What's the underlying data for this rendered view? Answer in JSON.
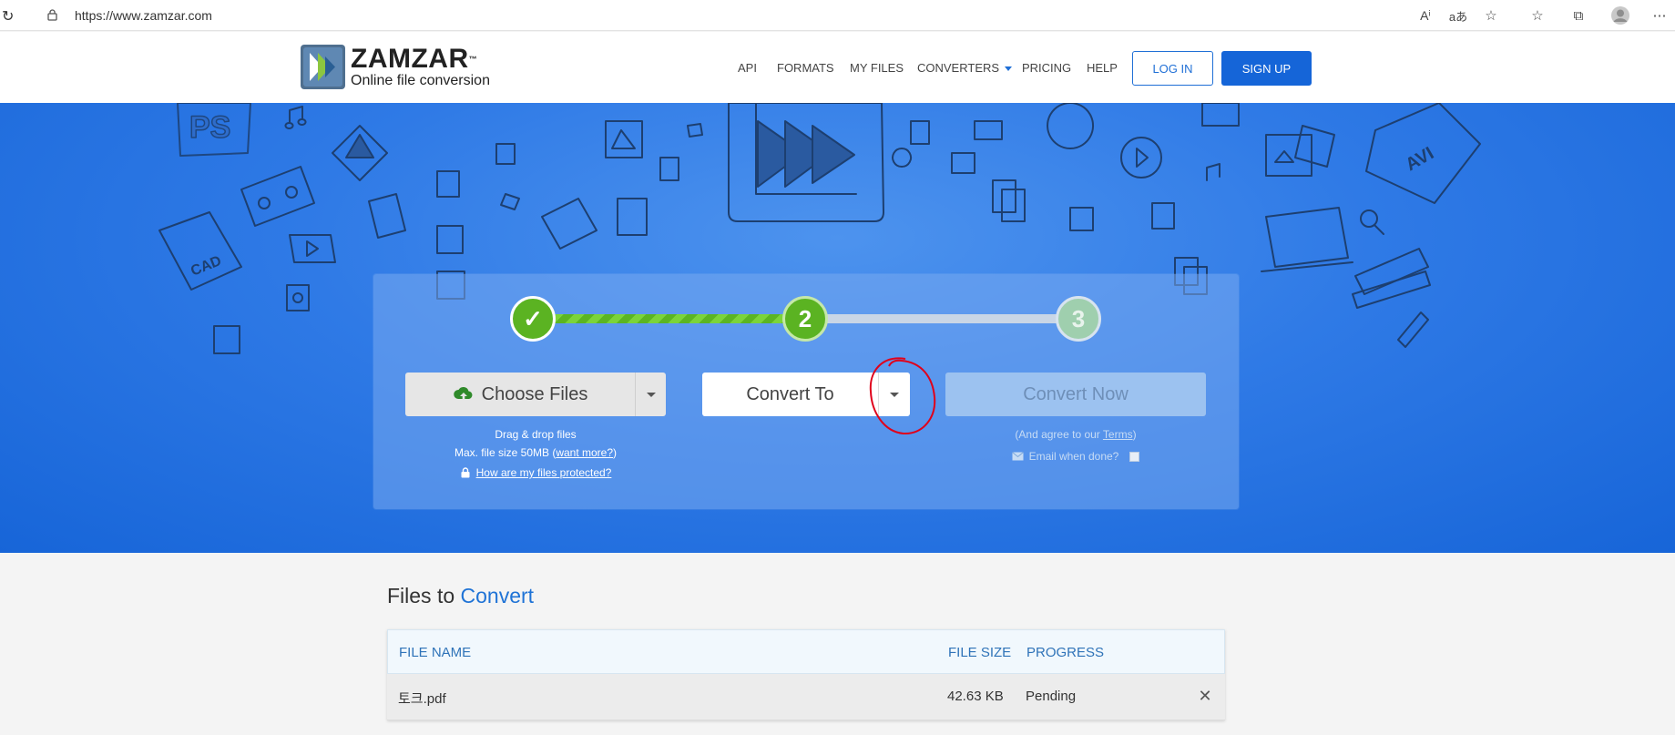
{
  "browser": {
    "url": "https://www.zamzar.com"
  },
  "header": {
    "logo_word": "ZAMZAR",
    "logo_tm": "™",
    "logo_tagline": "Online file conversion",
    "nav": [
      {
        "label": "API"
      },
      {
        "label": "FORMATS"
      },
      {
        "label": "MY FILES"
      },
      {
        "label": "CONVERTERS"
      },
      {
        "label": "PRICING"
      },
      {
        "label": "HELP"
      }
    ],
    "login_label": "LOG IN",
    "signup_label": "SIGN UP"
  },
  "converter": {
    "step1_label": "✓",
    "step2_label": "2",
    "step3_label": "3",
    "progress_fraction": 0.5,
    "choose_files_label": "Choose Files",
    "convert_to_label": "Convert To",
    "convert_now_label": "Convert Now",
    "drag_drop_text": "Drag & drop files",
    "max_size_text": "Max. file size 50MB (",
    "want_more_link": "want more?",
    "max_size_close": ")",
    "protected_link": "How are my files protected?",
    "agree_prefix": "(And agree to our ",
    "terms_link": "Terms",
    "agree_suffix": ")",
    "email_label": "Email when done?"
  },
  "files": {
    "title_prefix": "Files to ",
    "title_accent": "Convert",
    "columns": {
      "name": "FILE NAME",
      "size": "FILE SIZE",
      "progress": "PROGRESS"
    },
    "rows": [
      {
        "name": "토크.pdf",
        "size": "42.63 KB",
        "progress": "Pending"
      }
    ],
    "remove_glyph": "✕"
  },
  "colors": {
    "brand_blue": "#1565d8",
    "hero_blue": "#2f7ae6",
    "step_green": "#5bb322",
    "annotation_red": "#e0001a"
  }
}
